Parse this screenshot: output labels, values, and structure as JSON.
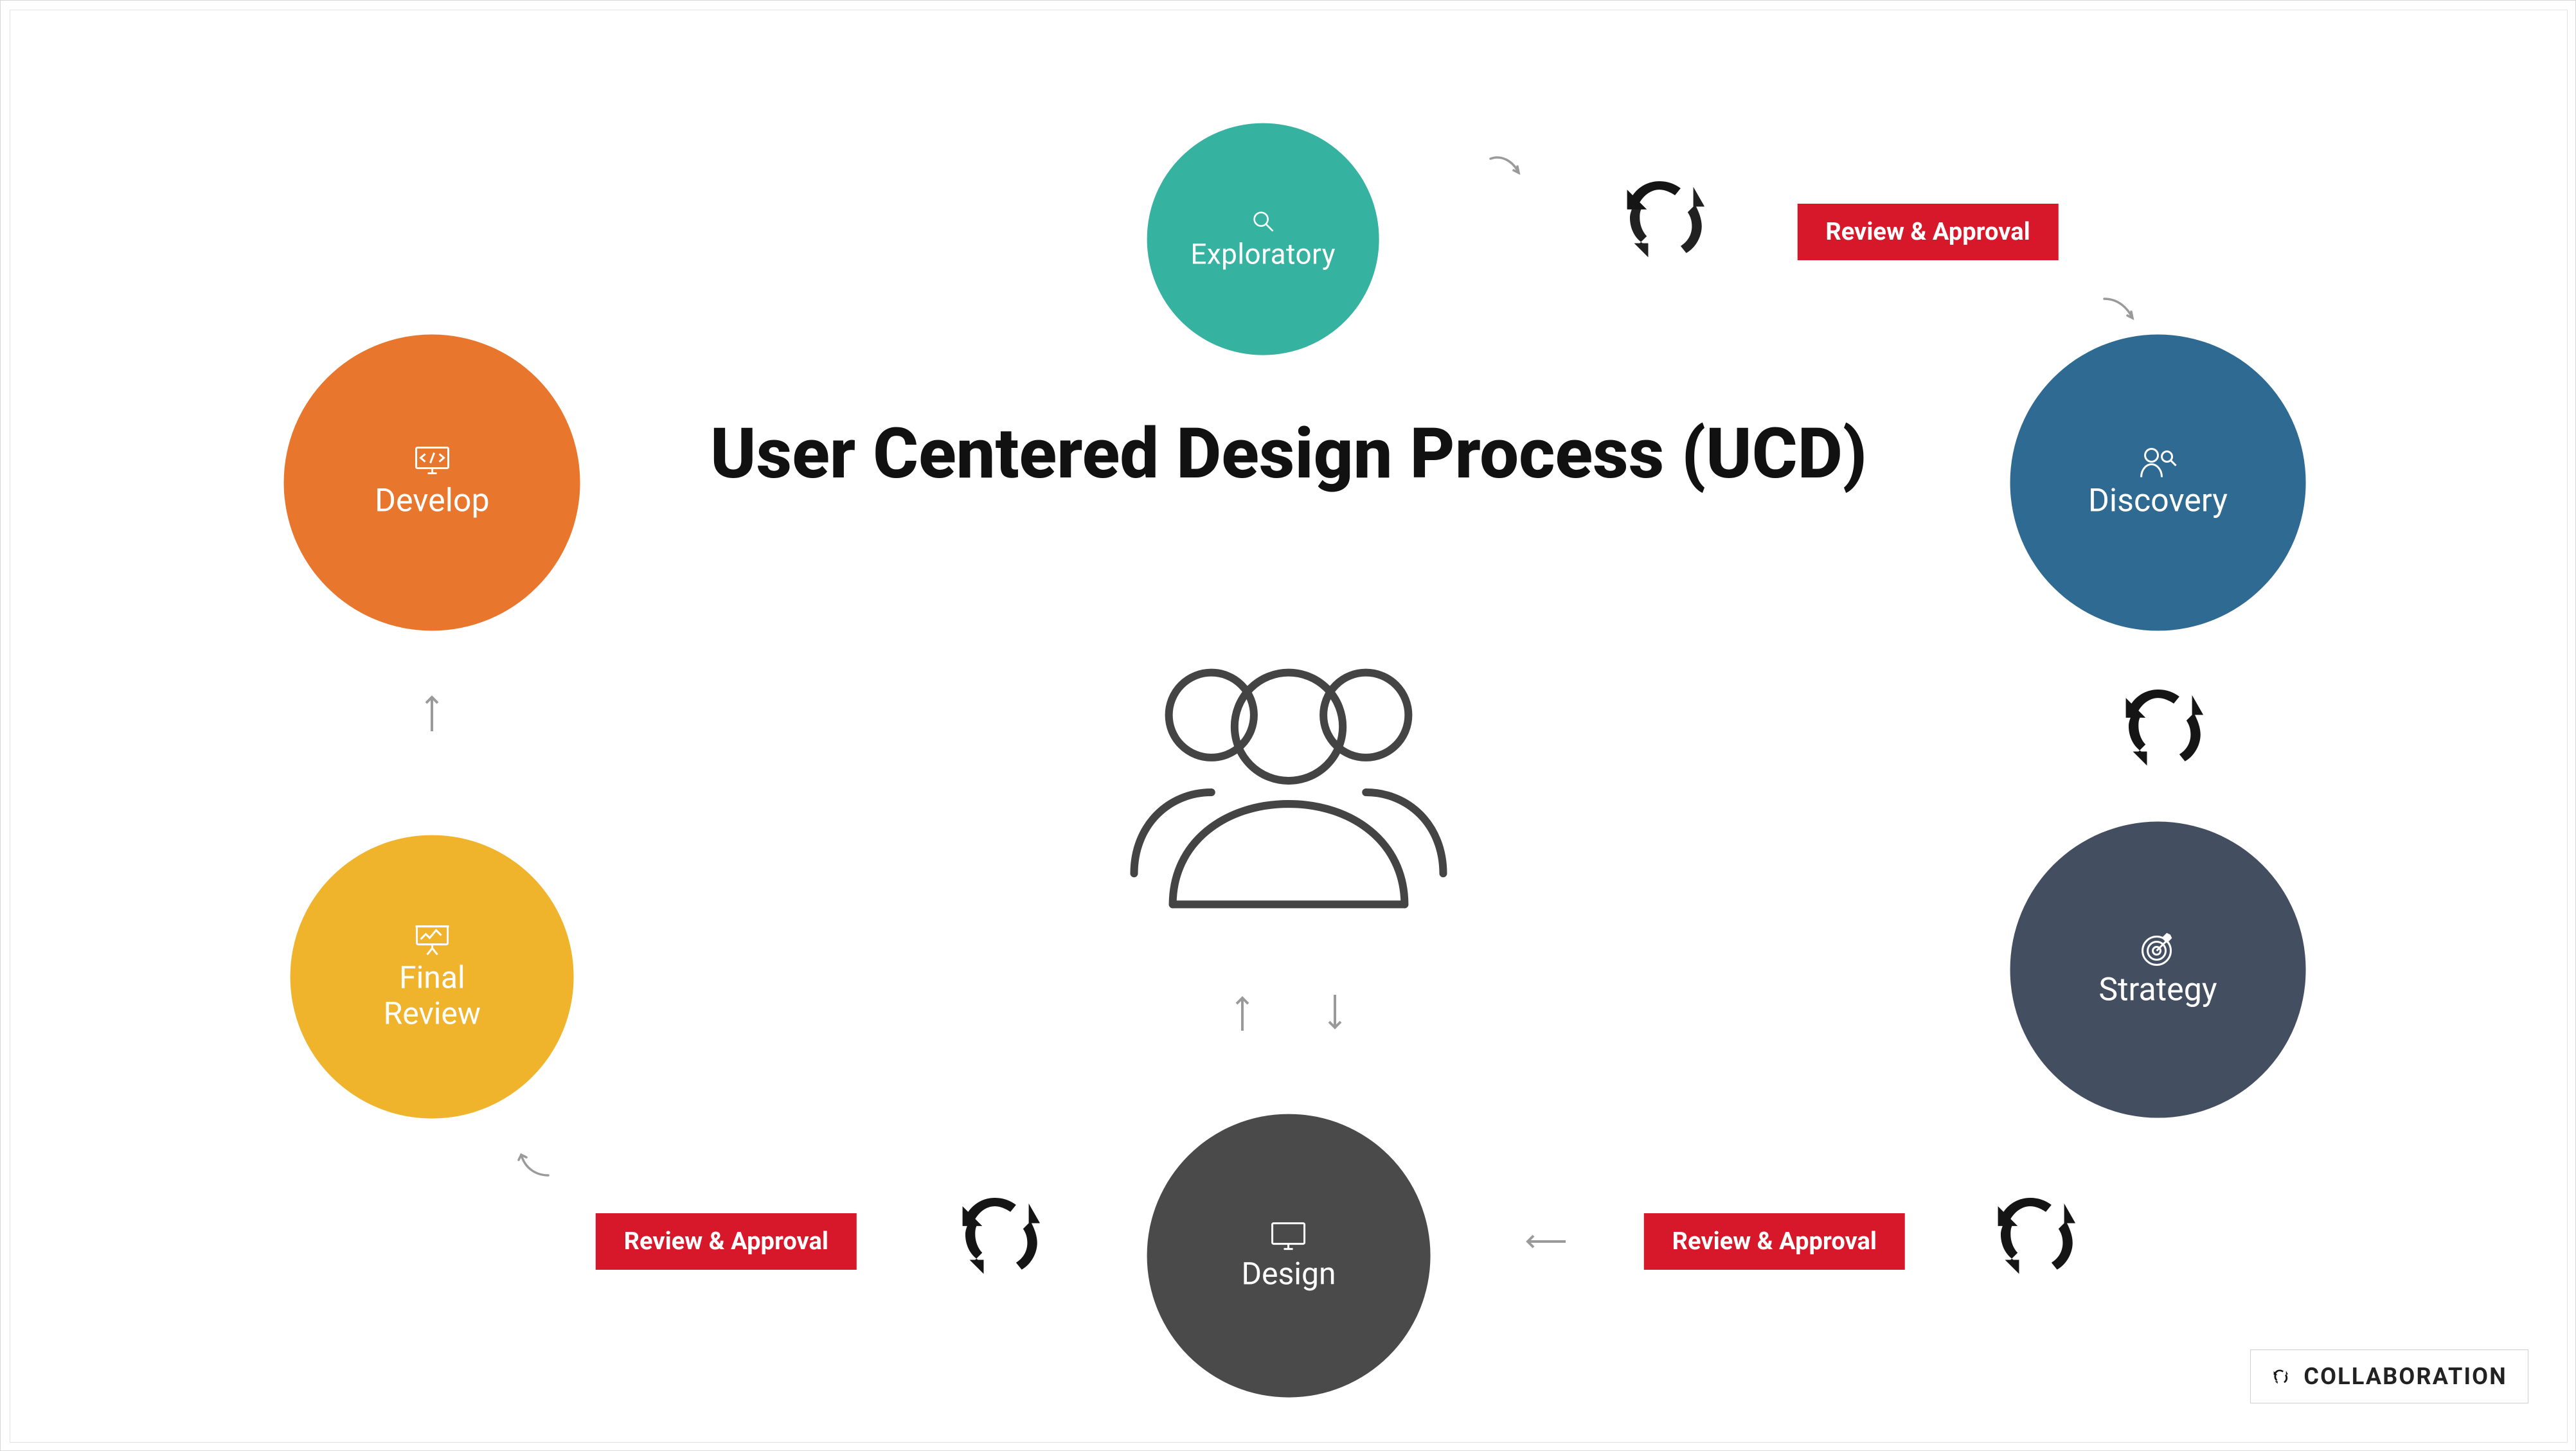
{
  "title": "User Centered Design Process (UCD)",
  "nodes": {
    "exploratory": {
      "label": "Exploratory",
      "color": "#36b2a0",
      "icon": "magnifier-icon"
    },
    "discovery": {
      "label": "Discovery",
      "color": "#2f6a92",
      "icon": "user-magnifier-icon"
    },
    "strategy": {
      "label": "Strategy",
      "color": "#434e60",
      "icon": "target-icon"
    },
    "design": {
      "label": "Design",
      "color": "#4a4a4a",
      "icon": "monitor-icon"
    },
    "final": {
      "label": "Final\nReview",
      "color": "#f0b42c",
      "icon": "chart-easel-icon"
    },
    "develop": {
      "label": "Develop",
      "color": "#e8762d",
      "icon": "code-monitor-icon"
    }
  },
  "badges": {
    "r1": "Review & Approval",
    "r2": "Review & Approval",
    "r3": "Review & Approval"
  },
  "legend": {
    "label": "COLLABORATION",
    "icon": "recycle-icon"
  },
  "center_icon": "people-icon"
}
